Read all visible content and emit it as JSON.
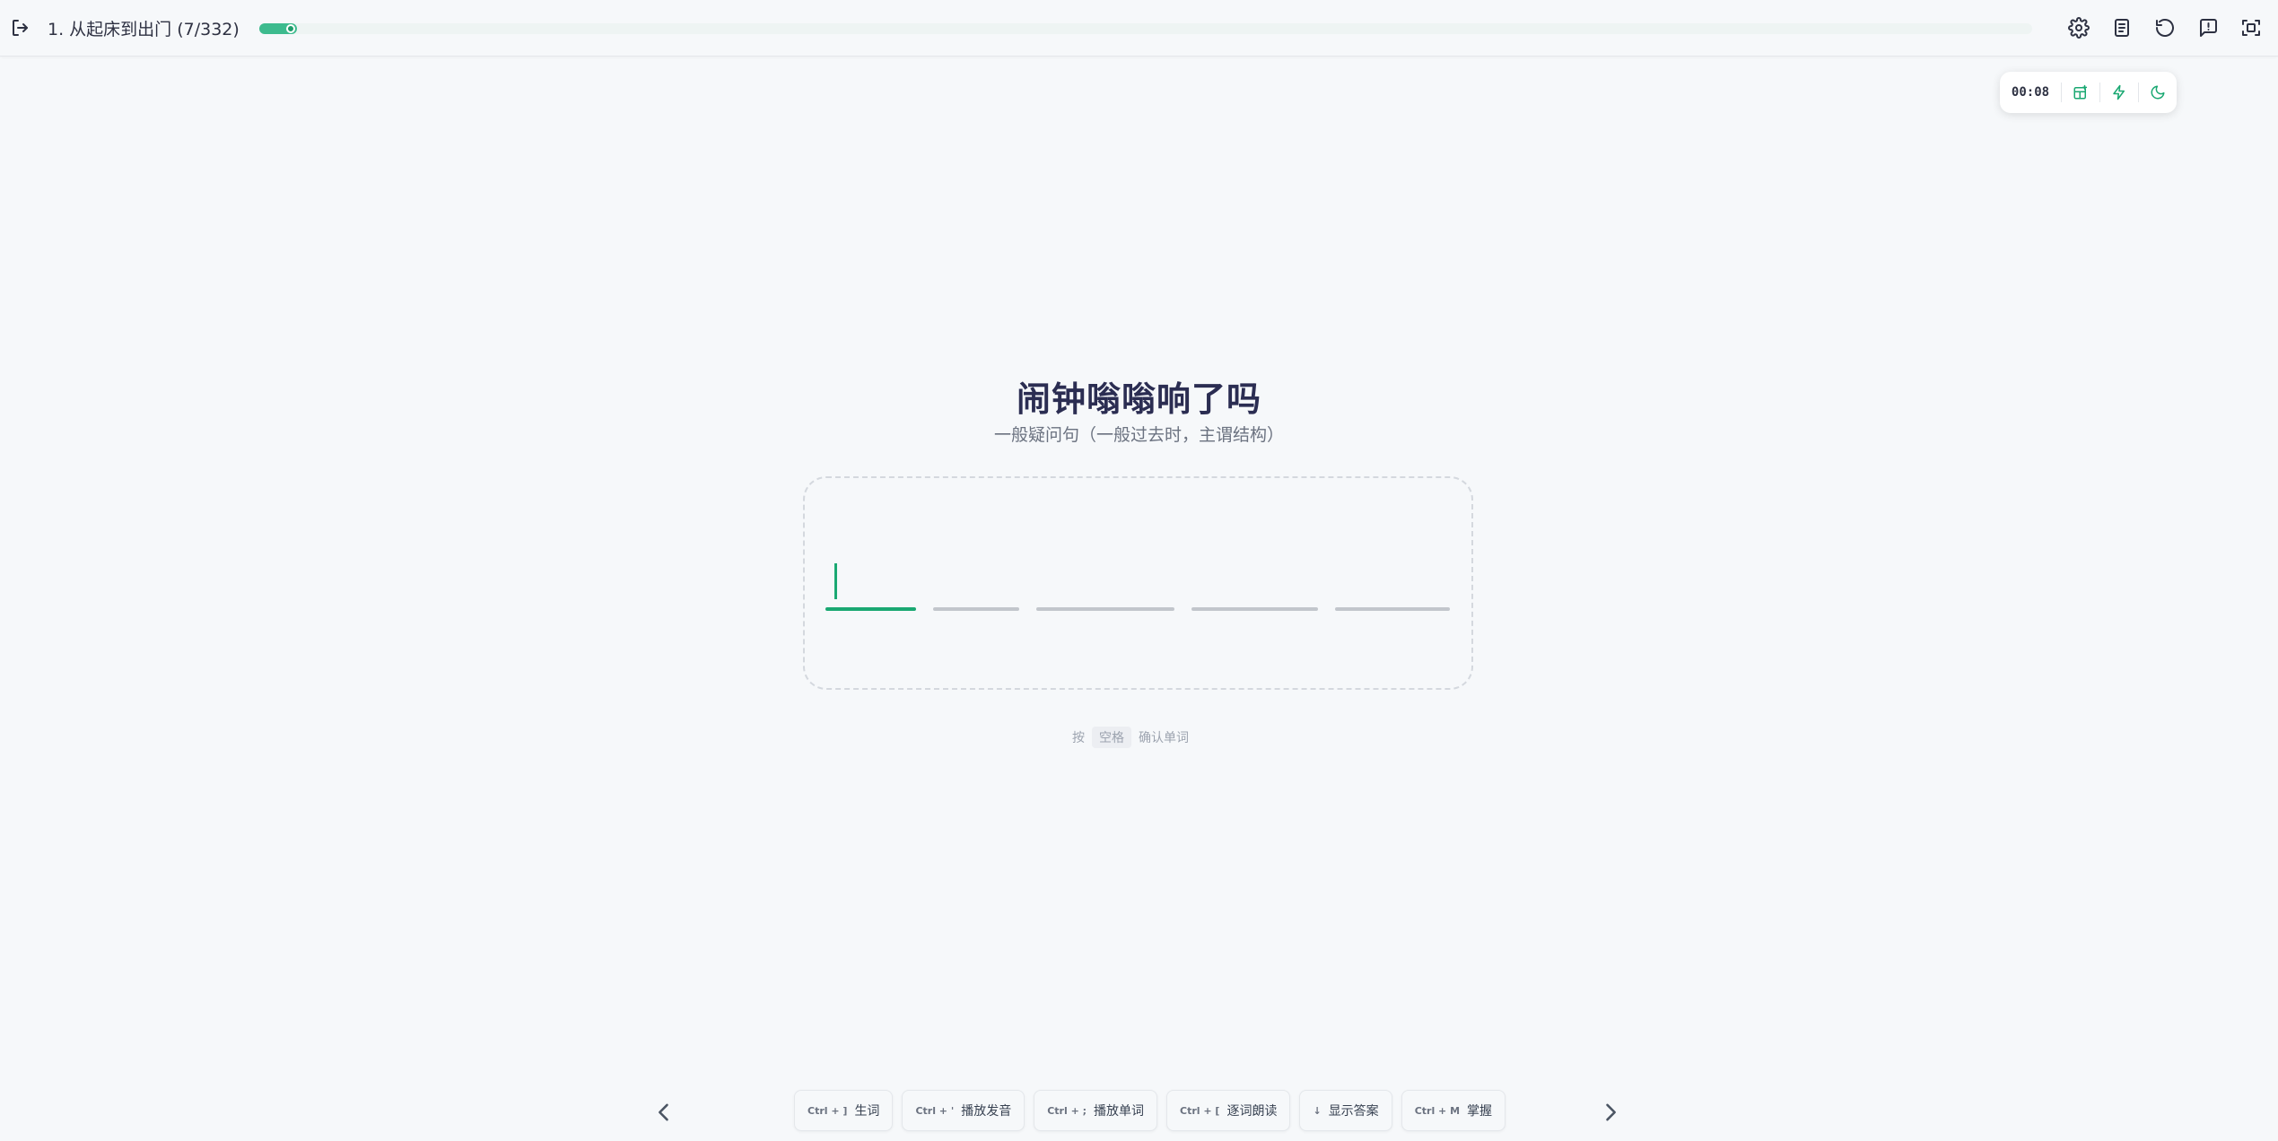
{
  "header": {
    "lesson_title": "1. 从起床到出门 (7/332)",
    "progress": {
      "current": 7,
      "total": 332
    },
    "icons": [
      "exit-icon",
      "gear-icon",
      "book-icon",
      "undo-icon",
      "feedback-icon",
      "fullscreen-icon"
    ]
  },
  "float_panel": {
    "timer": "00:08",
    "buttons": [
      "layout-icon",
      "lightning-icon",
      "moon-icon"
    ]
  },
  "prompt": {
    "chinese": "闹钟嗡嗡响了吗",
    "grammar": "一般疑问句（一般过去时，主谓结构）"
  },
  "answer": {
    "slot_count": 5,
    "active_slot": 0
  },
  "hint": {
    "prefix": "按",
    "key": "空格",
    "suffix": "确认单词"
  },
  "shortcuts": [
    {
      "key": "Ctrl + ]",
      "label": "生词"
    },
    {
      "key": "Ctrl + '",
      "label": "播放发音"
    },
    {
      "key": "Ctrl + ;",
      "label": "播放单词"
    },
    {
      "key": "Ctrl + [",
      "label": "逐词朗读"
    },
    {
      "key": "↓",
      "label": "显示答案"
    },
    {
      "key": "Ctrl + M",
      "label": "掌握"
    }
  ],
  "colors": {
    "accent": "#1aa872",
    "title": "#2b2d52",
    "background": "#f6f8fa"
  }
}
